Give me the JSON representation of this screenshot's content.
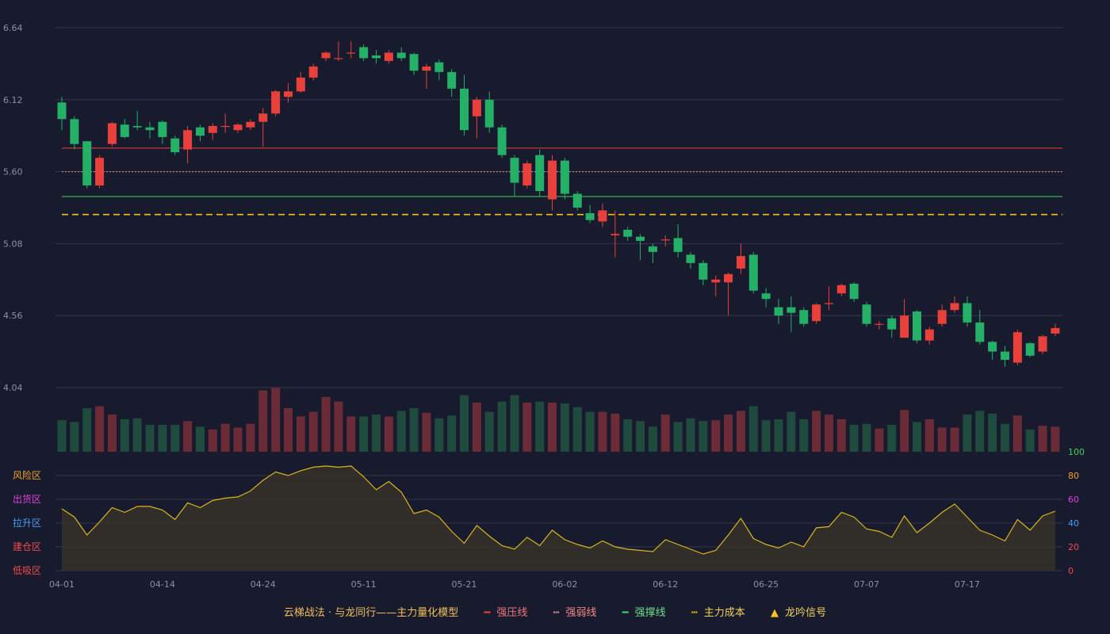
{
  "chart_data": {
    "type": "candlestick",
    "price_ylim": [
      4.04,
      6.64
    ],
    "price_ticks": [
      "6.64",
      "6.12",
      "5.60",
      "5.08",
      "4.56",
      "4.04"
    ],
    "x_ticks": [
      {
        "i": 0,
        "label": "04-01"
      },
      {
        "i": 8,
        "label": "04-14"
      },
      {
        "i": 16,
        "label": "04-24"
      },
      {
        "i": 24,
        "label": "05-11"
      },
      {
        "i": 32,
        "label": "05-21"
      },
      {
        "i": 40,
        "label": "06-02"
      },
      {
        "i": 48,
        "label": "06-12"
      },
      {
        "i": 56,
        "label": "06-25"
      },
      {
        "i": 64,
        "label": "07-07"
      },
      {
        "i": 72,
        "label": "07-17"
      }
    ],
    "candles": [
      [
        6.1,
        5.98,
        6.14,
        5.9
      ],
      [
        5.98,
        5.8,
        6.0,
        5.76
      ],
      [
        5.82,
        5.5,
        5.82,
        5.48
      ],
      [
        5.5,
        5.7,
        5.72,
        5.48
      ],
      [
        5.8,
        5.95,
        5.96,
        5.78
      ],
      [
        5.94,
        5.85,
        5.98,
        5.84
      ],
      [
        5.93,
        5.92,
        6.04,
        5.9
      ],
      [
        5.92,
        5.9,
        5.96,
        5.84
      ],
      [
        5.96,
        5.85,
        5.97,
        5.8
      ],
      [
        5.84,
        5.74,
        5.86,
        5.72
      ],
      [
        5.76,
        5.9,
        5.93,
        5.66
      ],
      [
        5.92,
        5.86,
        5.94,
        5.82
      ],
      [
        5.88,
        5.93,
        5.95,
        5.83
      ],
      [
        5.93,
        5.93,
        6.02,
        5.88
      ],
      [
        5.9,
        5.94,
        5.95,
        5.88
      ],
      [
        5.92,
        5.96,
        5.98,
        5.9
      ],
      [
        5.96,
        6.02,
        6.06,
        5.78
      ],
      [
        6.02,
        6.18,
        6.19,
        6.0
      ],
      [
        6.14,
        6.18,
        6.24,
        6.1
      ],
      [
        6.18,
        6.28,
        6.32,
        6.17
      ],
      [
        6.28,
        6.36,
        6.38,
        6.26
      ],
      [
        6.42,
        6.46,
        6.47,
        6.4
      ],
      [
        6.42,
        6.42,
        6.54,
        6.4
      ],
      [
        6.46,
        6.46,
        6.54,
        6.42
      ],
      [
        6.5,
        6.42,
        6.52,
        6.4
      ],
      [
        6.44,
        6.42,
        6.48,
        6.38
      ],
      [
        6.4,
        6.46,
        6.48,
        6.38
      ],
      [
        6.46,
        6.42,
        6.5,
        6.4
      ],
      [
        6.45,
        6.33,
        6.46,
        6.3
      ],
      [
        6.33,
        6.36,
        6.38,
        6.2
      ],
      [
        6.39,
        6.32,
        6.41,
        6.26
      ],
      [
        6.32,
        6.2,
        6.34,
        6.14
      ],
      [
        6.2,
        5.9,
        6.3,
        5.86
      ],
      [
        6.0,
        6.12,
        6.14,
        5.84
      ],
      [
        6.12,
        5.92,
        6.18,
        5.88
      ],
      [
        5.92,
        5.72,
        5.94,
        5.7
      ],
      [
        5.7,
        5.52,
        5.72,
        5.42
      ],
      [
        5.5,
        5.66,
        5.68,
        5.48
      ],
      [
        5.72,
        5.46,
        5.76,
        5.42
      ],
      [
        5.4,
        5.68,
        5.72,
        5.32
      ],
      [
        5.68,
        5.44,
        5.7,
        5.4
      ],
      [
        5.44,
        5.34,
        5.46,
        5.32
      ],
      [
        5.3,
        5.25,
        5.36,
        5.23
      ],
      [
        5.24,
        5.32,
        5.37,
        5.2
      ],
      [
        5.14,
        5.15,
        5.32,
        4.98
      ],
      [
        5.18,
        5.13,
        5.2,
        5.1
      ],
      [
        5.13,
        5.1,
        5.15,
        4.96
      ],
      [
        5.06,
        5.02,
        5.08,
        4.94
      ],
      [
        5.11,
        5.11,
        5.14,
        5.06
      ],
      [
        5.12,
        5.02,
        5.22,
        4.98
      ],
      [
        5.0,
        4.94,
        5.02,
        4.9
      ],
      [
        4.94,
        4.82,
        4.96,
        4.78
      ],
      [
        4.8,
        4.82,
        4.85,
        4.7
      ],
      [
        4.8,
        4.86,
        4.87,
        4.56
      ],
      [
        4.9,
        4.99,
        5.08,
        4.86
      ],
      [
        5.0,
        4.74,
        5.02,
        4.72
      ],
      [
        4.72,
        4.68,
        4.76,
        4.62
      ],
      [
        4.62,
        4.56,
        4.68,
        4.5
      ],
      [
        4.62,
        4.58,
        4.7,
        4.44
      ],
      [
        4.6,
        4.5,
        4.62,
        4.48
      ],
      [
        4.52,
        4.64,
        4.65,
        4.5
      ],
      [
        4.65,
        4.65,
        4.77,
        4.6
      ],
      [
        4.72,
        4.78,
        4.79,
        4.7
      ],
      [
        4.79,
        4.68,
        4.8,
        4.66
      ],
      [
        4.64,
        4.5,
        4.66,
        4.48
      ],
      [
        4.5,
        4.5,
        4.52,
        4.46
      ],
      [
        4.54,
        4.46,
        4.56,
        4.4
      ],
      [
        4.4,
        4.56,
        4.68,
        4.4
      ],
      [
        4.59,
        4.38,
        4.6,
        4.36
      ],
      [
        4.38,
        4.46,
        4.48,
        4.35
      ],
      [
        4.5,
        4.6,
        4.64,
        4.48
      ],
      [
        4.6,
        4.65,
        4.7,
        4.58
      ],
      [
        4.65,
        4.51,
        4.7,
        4.48
      ],
      [
        4.51,
        4.37,
        4.6,
        4.35
      ],
      [
        4.37,
        4.3,
        4.38,
        4.24
      ],
      [
        4.3,
        4.24,
        4.34,
        4.19
      ],
      [
        4.22,
        4.44,
        4.46,
        4.2
      ],
      [
        4.36,
        4.27,
        4.37,
        4.26
      ],
      [
        4.3,
        4.41,
        4.42,
        4.28
      ],
      [
        4.43,
        4.47,
        4.5,
        4.41
      ]
    ],
    "volume": [
      34,
      32,
      47,
      49,
      40,
      35,
      36,
      29,
      29,
      29,
      33,
      27,
      24,
      30,
      26,
      30,
      66,
      69,
      47,
      38,
      43,
      59,
      54,
      38,
      38,
      40,
      38,
      44,
      47,
      42,
      36,
      39,
      61,
      53,
      43,
      54,
      61,
      53,
      54,
      53,
      52,
      48,
      43,
      43,
      41,
      35,
      33,
      27,
      40,
      32,
      36,
      33,
      34,
      40,
      44,
      49,
      34,
      35,
      43,
      35,
      44,
      40,
      35,
      29,
      30,
      25,
      29,
      45,
      32,
      35,
      26,
      26,
      40,
      44,
      41,
      30,
      39,
      24,
      28,
      27
    ],
    "volume_max": 70,
    "strong_press_line": 5.77,
    "weak_line": 5.6,
    "support_line": 5.42,
    "main_cost_line": 5.29,
    "indicator_ylim": [
      0,
      100
    ],
    "indicator_ticks": [
      "100",
      "80",
      "60",
      "40",
      "20",
      "0"
    ],
    "indicator": [
      52,
      45,
      30,
      41,
      53,
      49,
      54,
      54,
      51,
      43,
      57,
      53,
      59,
      61,
      62,
      67,
      76,
      83,
      80,
      84,
      87,
      88,
      87,
      88,
      79,
      68,
      75,
      66,
      48,
      51,
      45,
      33,
      23,
      38,
      29,
      21,
      18,
      28,
      21,
      34,
      26,
      22,
      19,
      25,
      20,
      18,
      17,
      16,
      26,
      22,
      18,
      14,
      17,
      30,
      44,
      27,
      22,
      19,
      24,
      20,
      36,
      37,
      49,
      45,
      35,
      33,
      28,
      46,
      32,
      40,
      49,
      56,
      45,
      34,
      30,
      25,
      43,
      34,
      46,
      50
    ],
    "zones": [
      "风险区",
      "出货区",
      "拉升区",
      "建仓区",
      "低吸区"
    ],
    "legend": {
      "title": "云梯战法 · 与龙同行——主力量化模型",
      "strong_press": "强压线",
      "weak": "强弱线",
      "support": "强撑线",
      "main_cost": "主力成本",
      "signal": "龙吟信号"
    },
    "colors": {
      "up": "#e8413c",
      "down": "#25b067",
      "volume_up": "#6b2b37",
      "volume_down": "#1f4a3e",
      "strong_press": "#e8413c",
      "weak": "#f08a8a",
      "support": "#3fd15a",
      "main_cost": "#f2c31a",
      "indicator_line": "#d9b61c",
      "zone_risk": "#f0a030",
      "zone_ship": "#e040e0",
      "zone_lift": "#4a9cf5",
      "zone_build": "#f24a4a",
      "zone_low": "#f24a4a",
      "legend_text": "#f0c05a"
    }
  }
}
